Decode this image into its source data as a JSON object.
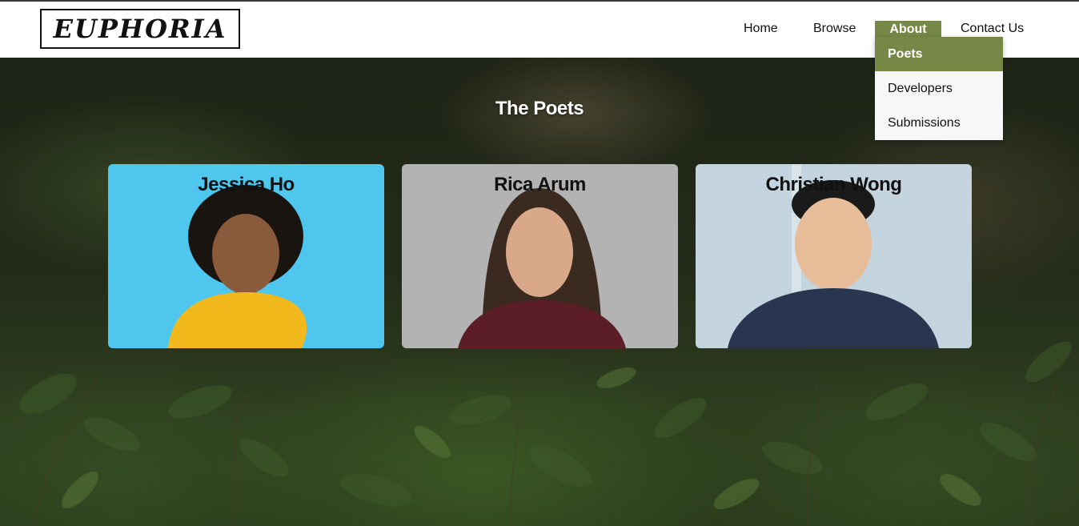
{
  "header": {
    "logo_text": "EUPHORIA",
    "nav": {
      "home": "Home",
      "browse": "Browse",
      "about": "About",
      "contact": "Contact Us"
    },
    "about_dropdown": [
      "Poets",
      "Developers",
      "Submissions"
    ],
    "accent_color": "#778846"
  },
  "main": {
    "section_title": "The Poets",
    "poets": [
      {
        "name": "Jessica Ho"
      },
      {
        "name": "Rica Arum"
      },
      {
        "name": "Christian Wong"
      }
    ]
  }
}
